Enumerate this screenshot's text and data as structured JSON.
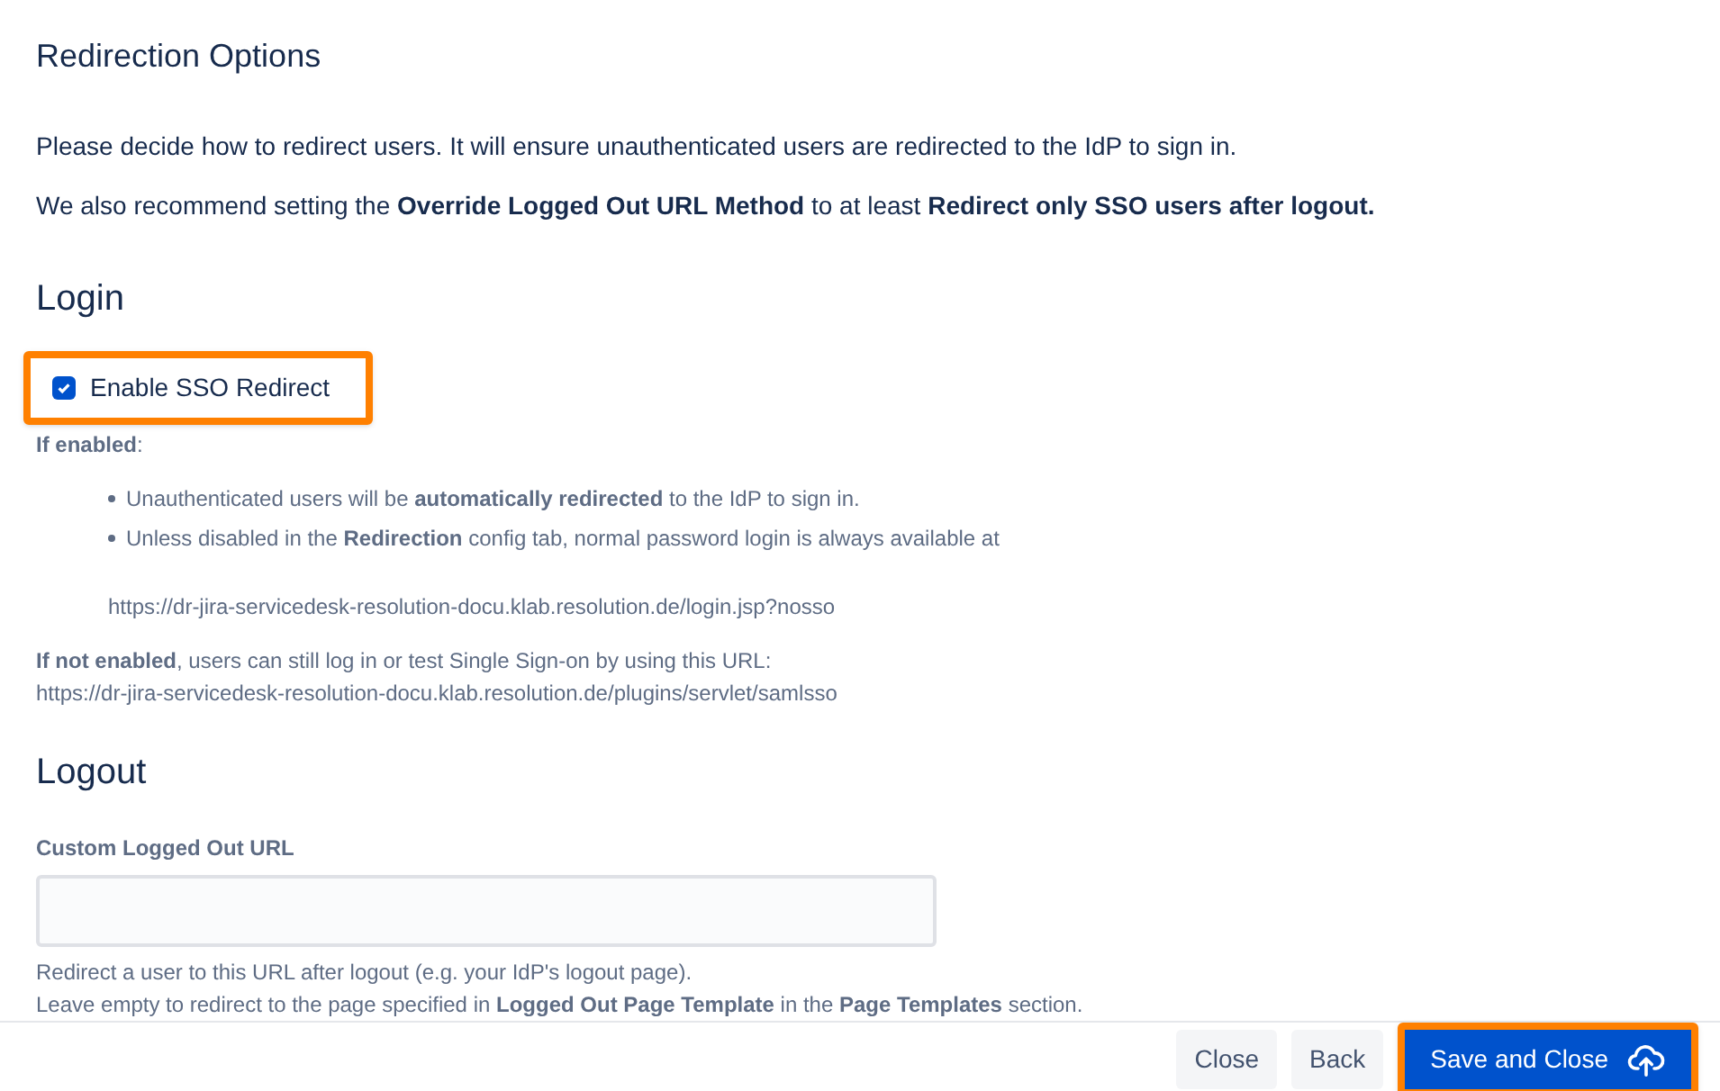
{
  "title": "Redirection Options",
  "intro": [
    "Please decide how to redirect users. It will ensure unauthenticated users are redirected to the IdP to sign in.",
    "We also recommend setting the **Override Logged Out URL Method** to at least **Redirect only SSO users after logout.**"
  ],
  "login": {
    "heading": "Login",
    "checkbox": {
      "label": "Enable SSO Redirect",
      "checked": true,
      "highlighted": true
    },
    "if_enabled": "**If enabled**:",
    "bullets": [
      "Unauthenticated users will be **automatically redirected** to the IdP to sign in.",
      "Unless disabled in the **Redirection** config tab, normal password login is always available at"
    ],
    "login_url": "https://dr-jira-servicedesk-resolution-docu.klab.resolution.de/login.jsp?nosso",
    "if_not_enabled": "**If not enabled**, users can still log in or test Single Sign-on by using this URL:",
    "sso_url": "https://dr-jira-servicedesk-resolution-docu.klab.resolution.de/plugins/servlet/samlsso"
  },
  "logout": {
    "heading": "Logout",
    "field_label": "Custom Logged Out URL",
    "help": [
      "Redirect a user to this URL after logout (e.g. your IdP's logout page).",
      "Leave empty to redirect to the page specified in **Logged Out Page Template** in the **Page Templates** section."
    ]
  },
  "buttons": [
    {
      "label": "Close",
      "kind": "subtle",
      "highlighted": false
    },
    {
      "label": "Back",
      "kind": "subtle",
      "highlighted": false
    },
    {
      "label": "Save and Close",
      "kind": "primary",
      "highlighted": true
    }
  ]
}
